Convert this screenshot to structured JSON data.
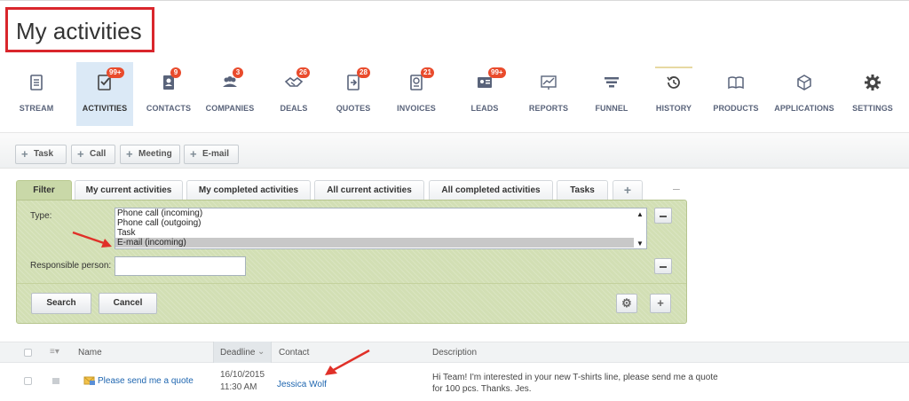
{
  "page": {
    "title": "My activities"
  },
  "nav": {
    "items": [
      {
        "label": "STREAM",
        "icon": "stream-icon",
        "badge": ""
      },
      {
        "label": "ACTIVITIES",
        "icon": "activities-icon",
        "badge": "99+"
      },
      {
        "label": "CONTACTS",
        "icon": "contacts-icon",
        "badge": "9"
      },
      {
        "label": "COMPANIES",
        "icon": "companies-icon",
        "badge": "3"
      },
      {
        "label": "DEALS",
        "icon": "deals-icon",
        "badge": "26"
      },
      {
        "label": "QUOTES",
        "icon": "quotes-icon",
        "badge": "28"
      },
      {
        "label": "INVOICES",
        "icon": "invoices-icon",
        "badge": "21"
      },
      {
        "label": "LEADS",
        "icon": "leads-icon",
        "badge": "99+"
      },
      {
        "label": "REPORTS",
        "icon": "reports-icon",
        "badge": ""
      },
      {
        "label": "FUNNEL",
        "icon": "funnel-icon",
        "badge": ""
      },
      {
        "label": "HISTORY",
        "icon": "history-icon",
        "badge": ""
      },
      {
        "label": "PRODUCTS",
        "icon": "products-icon",
        "badge": ""
      },
      {
        "label": "APPLICATIONS",
        "icon": "applications-icon",
        "badge": ""
      },
      {
        "label": "SETTINGS",
        "icon": "settings-icon",
        "badge": ""
      }
    ]
  },
  "toolbar": {
    "task": "Task",
    "call": "Call",
    "meeting": "Meeting",
    "email": "E-mail"
  },
  "tabs": {
    "filter": "Filter",
    "my_current": "My current activities",
    "my_completed": "My completed activities",
    "all_current": "All current activities",
    "all_completed": "All completed activities",
    "tasks": "Tasks",
    "add": "+",
    "more": "–"
  },
  "filter": {
    "type_label": "Type:",
    "type_options": [
      "Phone call (incoming)",
      "Phone call (outgoing)",
      "Task",
      "E-mail (incoming)"
    ],
    "selected_type": "E-mail (incoming)",
    "responsible_label": "Responsible person:",
    "responsible_value": "",
    "search_button": "Search",
    "cancel_button": "Cancel"
  },
  "grid": {
    "columns": {
      "name": "Name",
      "deadline": "Deadline",
      "contact": "Contact",
      "description": "Description"
    },
    "rows": [
      {
        "name": "Please send me a quote",
        "deadline_date": "16/10/2015",
        "deadline_time": "11:30 AM",
        "contact": "Jessica Wolf",
        "description": "Hi Team! I'm interested in your new T-shirts line, please send me a quote for 100 pcs. Thanks. Jes."
      }
    ]
  },
  "colors": {
    "accent_red": "#d9262c",
    "badge_red": "#e94b2c",
    "filter_green": "#d2dfb4",
    "active_nav": "#dbe9f6",
    "link_blue": "#2067b0"
  }
}
